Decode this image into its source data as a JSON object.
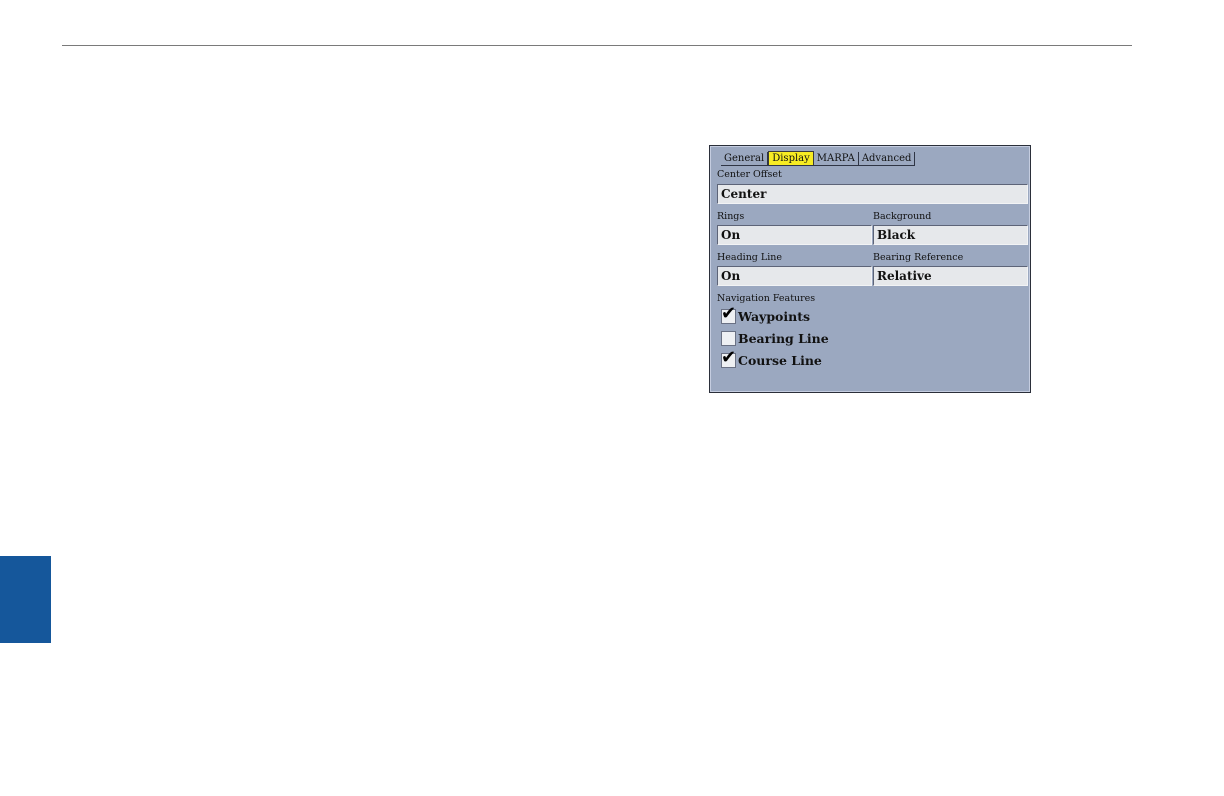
{
  "tabs": [
    {
      "label": "General",
      "active": false
    },
    {
      "label": "Display",
      "active": true
    },
    {
      "label": "MARPA",
      "active": false
    },
    {
      "label": "Advanced",
      "active": false
    }
  ],
  "center_offset": {
    "label": "Center Offset",
    "value": "Center"
  },
  "rings": {
    "label": "Rings",
    "value": "On"
  },
  "background": {
    "label": "Background",
    "value": "Black"
  },
  "heading_line": {
    "label": "Heading Line",
    "value": "On"
  },
  "bearing_reference": {
    "label": "Bearing Reference",
    "value": "Relative"
  },
  "navigation_features": {
    "label": "Navigation Features",
    "items": [
      {
        "label": "Waypoints",
        "checked": true
      },
      {
        "label": "Bearing Line",
        "checked": false
      },
      {
        "label": "Course Line",
        "checked": true
      }
    ]
  },
  "colors": {
    "side_tab": "#15579b",
    "screen_bg": "#9ba8c0",
    "active_tab": "#f7ec23",
    "field_bg": "#e6e8eb"
  }
}
